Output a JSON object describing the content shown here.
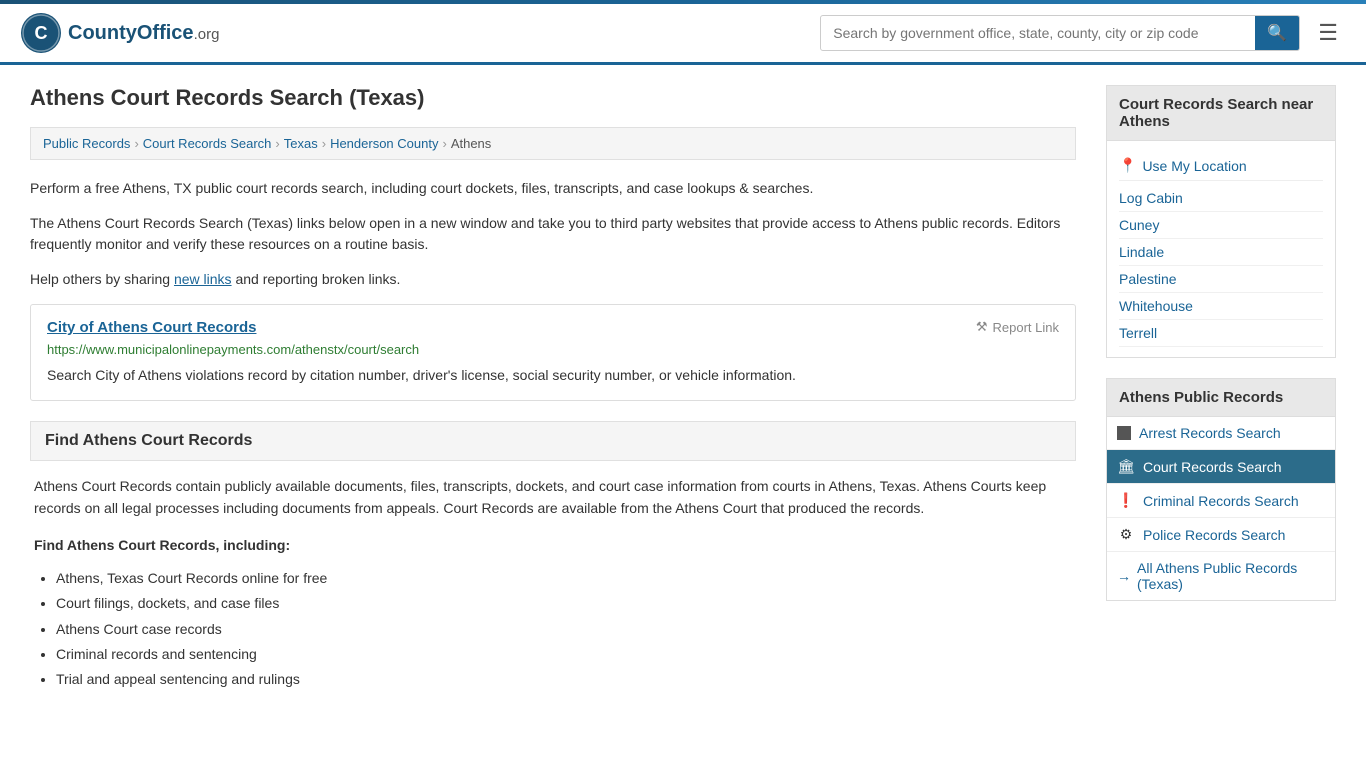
{
  "header": {
    "logo_text": "CountyOffice",
    "logo_suffix": ".org",
    "search_placeholder": "Search by government office, state, county, city or zip code",
    "search_value": ""
  },
  "page": {
    "title": "Athens Court Records Search (Texas)"
  },
  "breadcrumb": {
    "items": [
      {
        "label": "Public Records",
        "href": "#"
      },
      {
        "label": "Court Records Search",
        "href": "#"
      },
      {
        "label": "Texas",
        "href": "#"
      },
      {
        "label": "Henderson County",
        "href": "#"
      },
      {
        "label": "Athens",
        "href": "#"
      }
    ]
  },
  "description": {
    "para1": "Perform a free Athens, TX public court records search, including court dockets, files, transcripts, and case lookups & searches.",
    "para2": "The Athens Court Records Search (Texas) links below open in a new window and take you to third party websites that provide access to Athens public records. Editors frequently monitor and verify these resources on a routine basis.",
    "para3_prefix": "Help others by sharing ",
    "para3_link": "new links",
    "para3_suffix": " and reporting broken links."
  },
  "resource": {
    "title": "City of Athens Court Records",
    "url": "https://www.municipalonlinepayments.com/athenstx/court/search",
    "report_label": "Report Link",
    "description": "Search City of Athens violations record by citation number, driver's license, social security number, or vehicle information."
  },
  "find_section": {
    "heading": "Find Athens Court Records",
    "body_para": "Athens Court Records contain publicly available documents, files, transcripts, dockets, and court case information from courts in Athens, Texas. Athens Courts keep records on all legal processes including documents from appeals. Court Records are available from the Athens Court that produced the records.",
    "sub_heading": "Find Athens Court Records, including:",
    "list_items": [
      "Athens, Texas Court Records online for free",
      "Court filings, dockets, and case files",
      "Athens Court case records",
      "Criminal records and sentencing",
      "Trial and appeal sentencing and rulings"
    ]
  },
  "sidebar": {
    "nearby_section_title": "Court Records Search near Athens",
    "use_location_label": "Use My Location",
    "nearby_links": [
      {
        "label": "Log Cabin"
      },
      {
        "label": "Cuney"
      },
      {
        "label": "Lindale"
      },
      {
        "label": "Palestine"
      },
      {
        "label": "Whitehouse"
      },
      {
        "label": "Terrell"
      }
    ],
    "public_records_title": "Athens Public Records",
    "public_records_items": [
      {
        "label": "Arrest Records Search",
        "icon": "■",
        "active": false
      },
      {
        "label": "Court Records Search",
        "icon": "🏛",
        "active": true
      },
      {
        "label": "Criminal Records Search",
        "icon": "❗",
        "active": false
      },
      {
        "label": "Police Records Search",
        "icon": "⚙",
        "active": false
      }
    ],
    "all_records_label": "All Athens Public Records (Texas)"
  }
}
